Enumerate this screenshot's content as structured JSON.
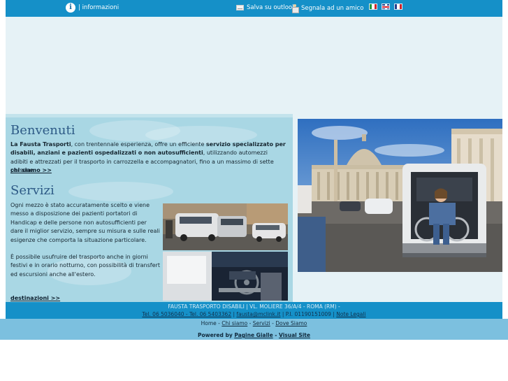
{
  "topbar": {
    "info_label": "| informazioni",
    "outlook_label": "Salva su outlook",
    "friend_label": "Segnala ad un amico"
  },
  "benvenuti": {
    "title": "Benvenuti",
    "company": "La Fausta Trasporti",
    "text1": ", con trentennale esperienza, offre un efficiente ",
    "bold1": "servizio specializzato per disabili, anziani e pazienti ospedalizzati  o non autosufficienti",
    "text2": ", utilizzando automezzi adibiti e attrezzati per il trasporto in carrozzella e accompagnatori, fino a un massimo di sette persone.",
    "link": "chi siamo >>"
  },
  "servizi": {
    "title": "Servizi",
    "para1": "Ogni mezzo è stato accuratamente scelto e viene messo a disposizione dei pazienti portatori di Handicap e delle persone non autosufficienti per dare il miglior servizio, sempre su misura e sulle reali esigenze che comporta la situazione particolare.",
    "para2": "È possibile usufruire del trasporto anche in giorni festivi e in orario notturno, con possibilità di transfert ed escursioni anche all'estero.",
    "link": "destinazioni >>"
  },
  "footer": {
    "line1": "FAUSTA TRASPORTO DISABILI | VL. MOLIERE 36/A/4 - ROMA (RM) -",
    "phones": "Tel. 06 5036040 - Tel. 06 5403362",
    "sep1": " | ",
    "email": "fausta@mclink.it",
    "piva": " | P.I. 01190151009 | ",
    "legal": "Note Legali",
    "nav_home": "Home",
    "nav_chi": "Chi siamo",
    "nav_servizi": "Servizi",
    "nav_dove": "Dove Siamo",
    "nav_sep": " - ",
    "powered": "Powered by ",
    "pg": "Pagine Gialle",
    "dash": " - ",
    "vs": "Visual Site"
  },
  "colors": {
    "topbar": "#1590c8",
    "panel": "#a9d7e4",
    "heading": "#2d5a86"
  },
  "icons": [
    "info-icon",
    "outlook-icon",
    "friend-icon",
    "flag-italy-icon",
    "flag-uk-icon",
    "flag-france-icon"
  ]
}
